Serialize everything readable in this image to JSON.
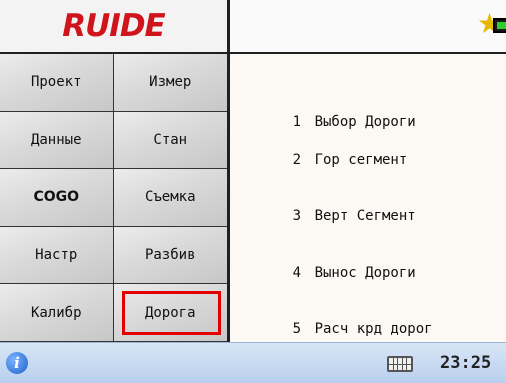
{
  "brand": {
    "logo_text": "RUIDE",
    "logo_color": "#d0141c"
  },
  "menu": [
    {
      "label": "Проект"
    },
    {
      "label": "Измер"
    },
    {
      "label": "Данные"
    },
    {
      "label": "Стан"
    },
    {
      "label": "COGO"
    },
    {
      "label": "Съемка"
    },
    {
      "label": "Настр"
    },
    {
      "label": "Разбив"
    },
    {
      "label": "Калибр"
    },
    {
      "label": "Дорога",
      "selected": true
    }
  ],
  "list": [
    {
      "num": "1",
      "label": "Выбор Дороги"
    },
    {
      "num": "2",
      "label": "Гор сегмент"
    },
    {
      "num": "3",
      "label": "Верт Сегмент"
    },
    {
      "num": "4",
      "label": "Вынос Дороги"
    },
    {
      "num": "5",
      "label": "Расч крд дорог"
    }
  ],
  "status": {
    "star_icon": "star-icon",
    "battery_icon": "battery-icon",
    "battery_level": 1.0
  },
  "taskbar": {
    "info_icon": "info-icon",
    "keyboard_icon": "keyboard-icon",
    "time": "23:25"
  },
  "colors": {
    "selection": "#e40000",
    "star": "#e6b800",
    "battery": "#2ecc2e"
  }
}
